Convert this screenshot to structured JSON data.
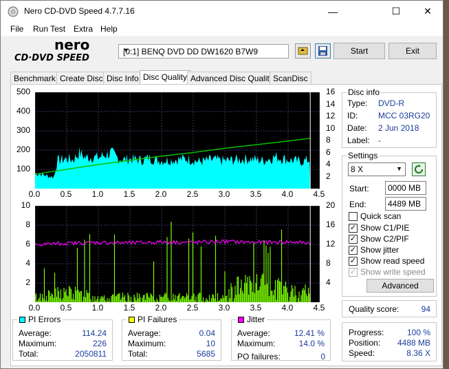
{
  "window": {
    "title": "Nero CD-DVD Speed 4.7.7.16",
    "minimize": "—",
    "maximize": "☐",
    "close": "✕"
  },
  "menu": [
    "File",
    "Run Test",
    "Extra",
    "Help"
  ],
  "toolbar": {
    "logo_top": "nero",
    "logo_bottom": "CD·DVD SPEED",
    "drive": "[0:1]   BENQ DVD DD DW1620 B7W9",
    "start": "Start",
    "exit": "Exit",
    "icons": [
      "eject-icon",
      "save-icon"
    ]
  },
  "tabs": [
    "Benchmark",
    "Create Disc",
    "Disc Info",
    "Disc Quality",
    "Advanced Disc Quality",
    "ScanDisc"
  ],
  "active_tab": "Disc Quality",
  "chart_data": [
    {
      "type": "area",
      "name": "PI Errors / Read speed",
      "x_ticks": [
        "0.0",
        "0.5",
        "1.0",
        "1.5",
        "2.0",
        "2.5",
        "3.0",
        "3.5",
        "4.0",
        "4.5"
      ],
      "xlim": [
        0,
        4.5
      ],
      "y_left_ticks": [
        "500",
        "400",
        "300",
        "200",
        "100"
      ],
      "ylim_left": [
        0,
        500
      ],
      "y_right_ticks": [
        "16",
        "14",
        "12",
        "10",
        "8",
        "6",
        "4",
        "2"
      ],
      "ylim_right": [
        0,
        16
      ],
      "grid": true,
      "series": [
        {
          "color": "#00ffff",
          "x": [
            0,
            0.1,
            0.2,
            0.3,
            0.35,
            0.5,
            0.6,
            0.7,
            0.8,
            0.9,
            1.0,
            1.1,
            1.2,
            1.3,
            1.4,
            1.5,
            1.6,
            1.7,
            1.8,
            1.9,
            2.0,
            2.2,
            2.4,
            2.6,
            2.8,
            3.0,
            3.2,
            3.4,
            3.6,
            3.8,
            4.0,
            4.2,
            4.35,
            4.5
          ],
          "values": [
            80,
            75,
            65,
            60,
            145,
            155,
            150,
            185,
            160,
            165,
            160,
            175,
            185,
            160,
            150,
            155,
            150,
            148,
            160,
            150,
            145,
            150,
            155,
            140,
            150,
            145,
            150,
            155,
            145,
            165,
            150,
            140,
            150,
            140
          ]
        },
        {
          "color": "#00c000",
          "axis": "right",
          "x": [
            0,
            0.5,
            1.0,
            1.5,
            2.0,
            2.5,
            3.0,
            3.5,
            4.0,
            4.35
          ],
          "values": [
            2.4,
            3.2,
            4.0,
            4.7,
            5.4,
            6.0,
            6.7,
            7.3,
            7.9,
            8.36
          ]
        }
      ]
    },
    {
      "type": "bar",
      "name": "PI Failures / Jitter",
      "x_ticks": [
        "0.0",
        "0.5",
        "1.0",
        "1.5",
        "2.0",
        "2.5",
        "3.0",
        "3.5",
        "4.0",
        "4.5"
      ],
      "xlim": [
        0,
        4.5
      ],
      "y_left_ticks": [
        "10",
        "8",
        "6",
        "4",
        "2"
      ],
      "ylim_left": [
        0,
        10
      ],
      "y_right_ticks": [
        "20",
        "16",
        "12",
        "8",
        "4"
      ],
      "ylim_right": [
        0,
        20
      ],
      "grid": true,
      "series": [
        {
          "color": "#7cfc00",
          "x": [
            0,
            0.5,
            1.0,
            1.5,
            2.0,
            2.5,
            3.0,
            3.2,
            3.5,
            3.8,
            4.0,
            4.35
          ],
          "values": [
            1,
            2,
            1,
            1,
            1,
            1,
            1,
            3,
            3,
            3,
            2,
            2
          ]
        },
        {
          "color": "#ff00ff",
          "axis": "right",
          "x": [
            0,
            0.5,
            1.0,
            1.5,
            2.0,
            2.5,
            3.0,
            3.5,
            4.0,
            4.35
          ],
          "values": [
            12.0,
            12.2,
            12.4,
            12.3,
            12.5,
            12.4,
            12.6,
            12.4,
            12.5,
            12.3
          ]
        }
      ]
    }
  ],
  "pi_errors": {
    "label": "PI Errors",
    "color": "#00ffff",
    "average_label": "Average:",
    "average": "114.24",
    "maximum_label": "Maximum:",
    "maximum": "226",
    "total_label": "Total:",
    "total": "2050811"
  },
  "pi_failures": {
    "label": "PI Failures",
    "color": "#ffff00",
    "average_label": "Average:",
    "average": "0.04",
    "maximum_label": "Maximum:",
    "maximum": "10",
    "total_label": "Total:",
    "total": "5685"
  },
  "jitter": {
    "label": "Jitter",
    "color": "#ff00ff",
    "average_label": "Average:",
    "average": "12.41 %",
    "maximum_label": "Maximum:",
    "maximum": "14.0 %",
    "po_label": "PO failures:",
    "po": "0"
  },
  "disc_info": {
    "header": "Disc info",
    "type_label": "Type:",
    "type": "DVD-R",
    "id_label": "ID:",
    "id": "MCC 03RG20",
    "date_label": "Date:",
    "date": "2 Jun 2018",
    "label_label": "Label:",
    "label": "-"
  },
  "settings": {
    "header": "Settings",
    "speed": "8 X",
    "start_label": "Start:",
    "start": "0000 MB",
    "end_label": "End:",
    "end": "4489 MB",
    "quick_scan": "Quick scan",
    "show_c1": "Show C1/PIE",
    "show_c2": "Show C2/PIF",
    "show_jitter": "Show jitter",
    "show_read": "Show read speed",
    "show_write": "Show write speed",
    "advanced": "Advanced"
  },
  "quality": {
    "label": "Quality score:",
    "value": "94"
  },
  "progress": {
    "progress_label": "Progress:",
    "progress": "100 %",
    "position_label": "Position:",
    "position": "4488 MB",
    "speed_label": "Speed:",
    "speed": "8.36 X"
  }
}
